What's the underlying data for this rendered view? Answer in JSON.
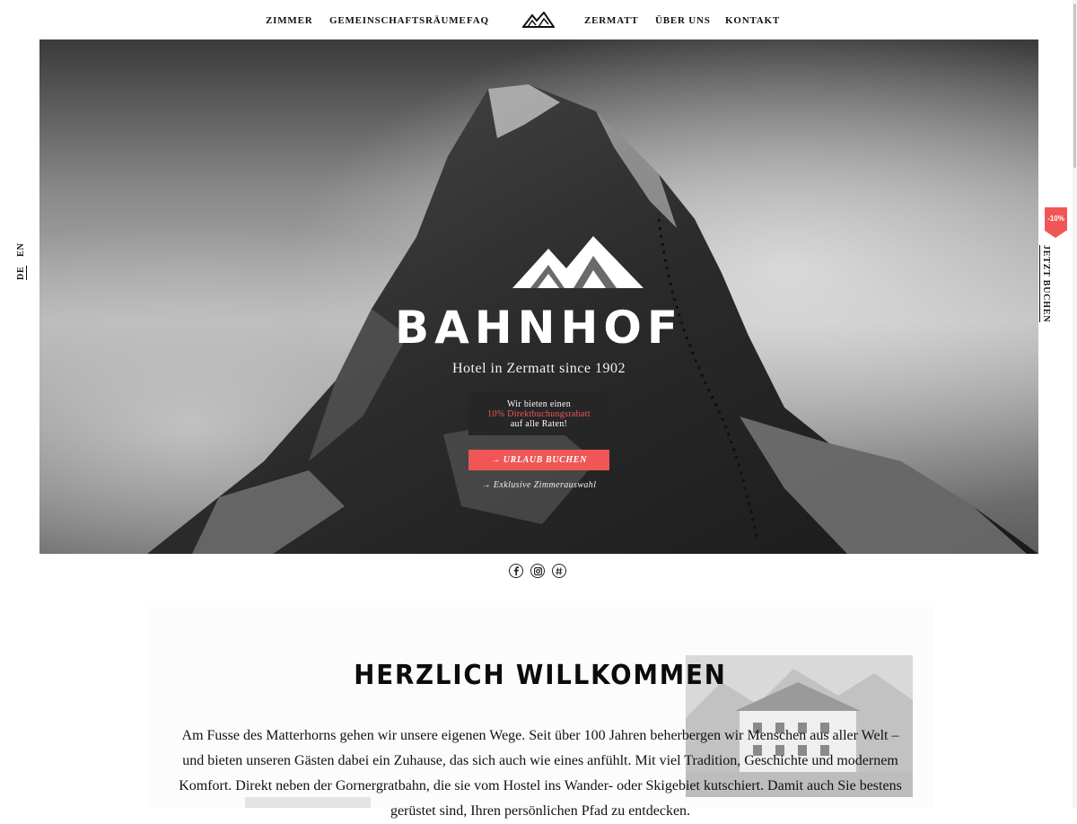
{
  "nav": {
    "items": [
      "ZIMMER",
      "GEMEINSCHAFTSRÄUME",
      "FAQ",
      "ZERMATT",
      "ÜBER UNS",
      "KONTAKT"
    ]
  },
  "language": {
    "de": "DE",
    "en": "EN"
  },
  "hero": {
    "title": "BAHNHOF",
    "subtitle": "Hotel in Zermatt since 1902",
    "promo_line1": "Wir bieten einen",
    "promo_highlight": "10% Direktbuchungsrabatt",
    "promo_line3": "auf alle Raten!",
    "cta": "→ URLAUB BUCHEN",
    "sub_link": "→ Exklusive Zimmerauswahl"
  },
  "booking_tab": {
    "badge": "-10%",
    "label": "JETZT BUCHEN"
  },
  "social": [
    "facebook-icon",
    "instagram-icon",
    "hashtag-icon"
  ],
  "welcome": {
    "title": "HERZLICH WILLKOMMEN",
    "lines": [
      "Am Fusse des Matterhorns gehen wir unsere eigenen Wege. Seit über 100 Jahren beherbergen wir Menschen aus aller Welt –",
      "und bieten unseren Gästen dabei ein Zuhause, das sich auch wie eines anfühlt. Mit viel Tradition, Geschichte und modernem",
      "Komfort. Direkt neben der Gornergratbahn, die sie vom Hostel ins Wander- oder Skigebiet kutschiert. Damit auch Sie bestens",
      "gerüstet sind, Ihren persönlichen Pfad zu entdecken."
    ]
  },
  "colors": {
    "accent": "#f05656",
    "dark": "#262626"
  }
}
